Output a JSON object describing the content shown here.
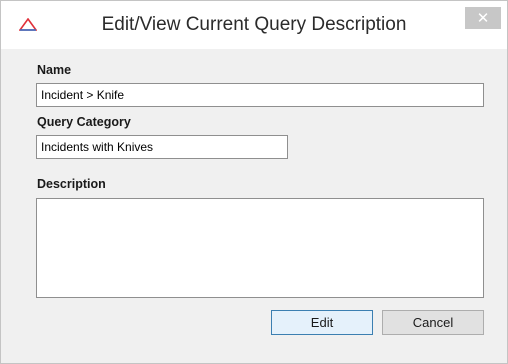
{
  "window": {
    "title": "Edit/View Current Query Description",
    "close_glyph": "✕",
    "app_icon": "app-logo-icon",
    "accent": "#e0303a"
  },
  "form": {
    "name_label": "Name",
    "name_value": "Incident > Knife",
    "category_label": "Query Category",
    "category_value": "Incidents with Knives",
    "description_label": "Description",
    "description_value": ""
  },
  "buttons": {
    "edit_label": "Edit",
    "cancel_label": "Cancel"
  }
}
